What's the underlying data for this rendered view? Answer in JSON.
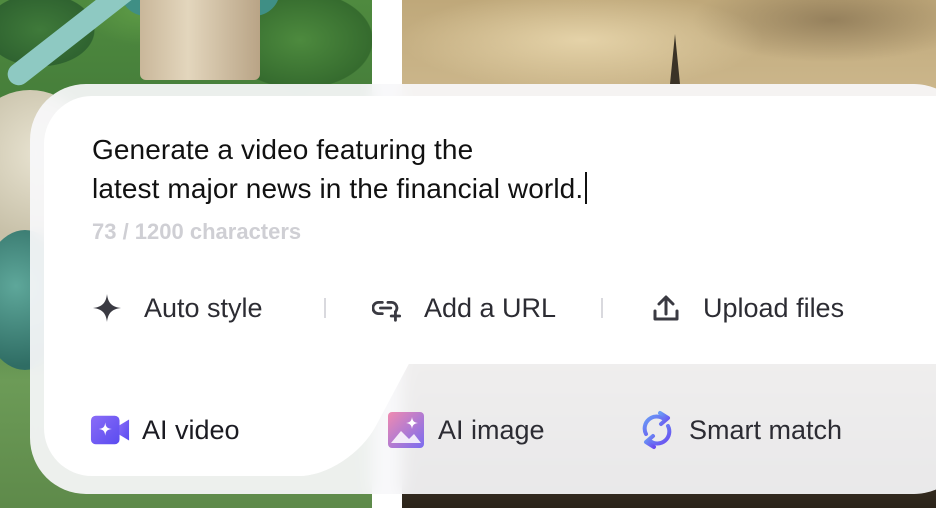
{
  "prompt": {
    "line1": "Generate a video featuring the",
    "line2": "latest major news in the financial world.",
    "counter": "73 / 1200 characters"
  },
  "actions": [
    {
      "label": "Auto style",
      "icon": "sparkle-icon"
    },
    {
      "label": "Add a URL",
      "icon": "link-add-icon"
    },
    {
      "label": "Upload files",
      "icon": "upload-icon"
    }
  ],
  "modes": [
    {
      "label": "AI video",
      "icon": "video-camera-icon",
      "active": true
    },
    {
      "label": "AI image",
      "icon": "image-icon",
      "active": false
    },
    {
      "label": "Smart match",
      "icon": "refresh-arrows-icon",
      "active": false
    }
  ],
  "colors": {
    "accent_video": "#6a5cf5",
    "accent_image_start": "#f07fb0",
    "accent_image_end": "#7a6cf0",
    "accent_match": "#5b6ef0",
    "text": "#2c2c33",
    "muted": "#cfcfd4"
  }
}
